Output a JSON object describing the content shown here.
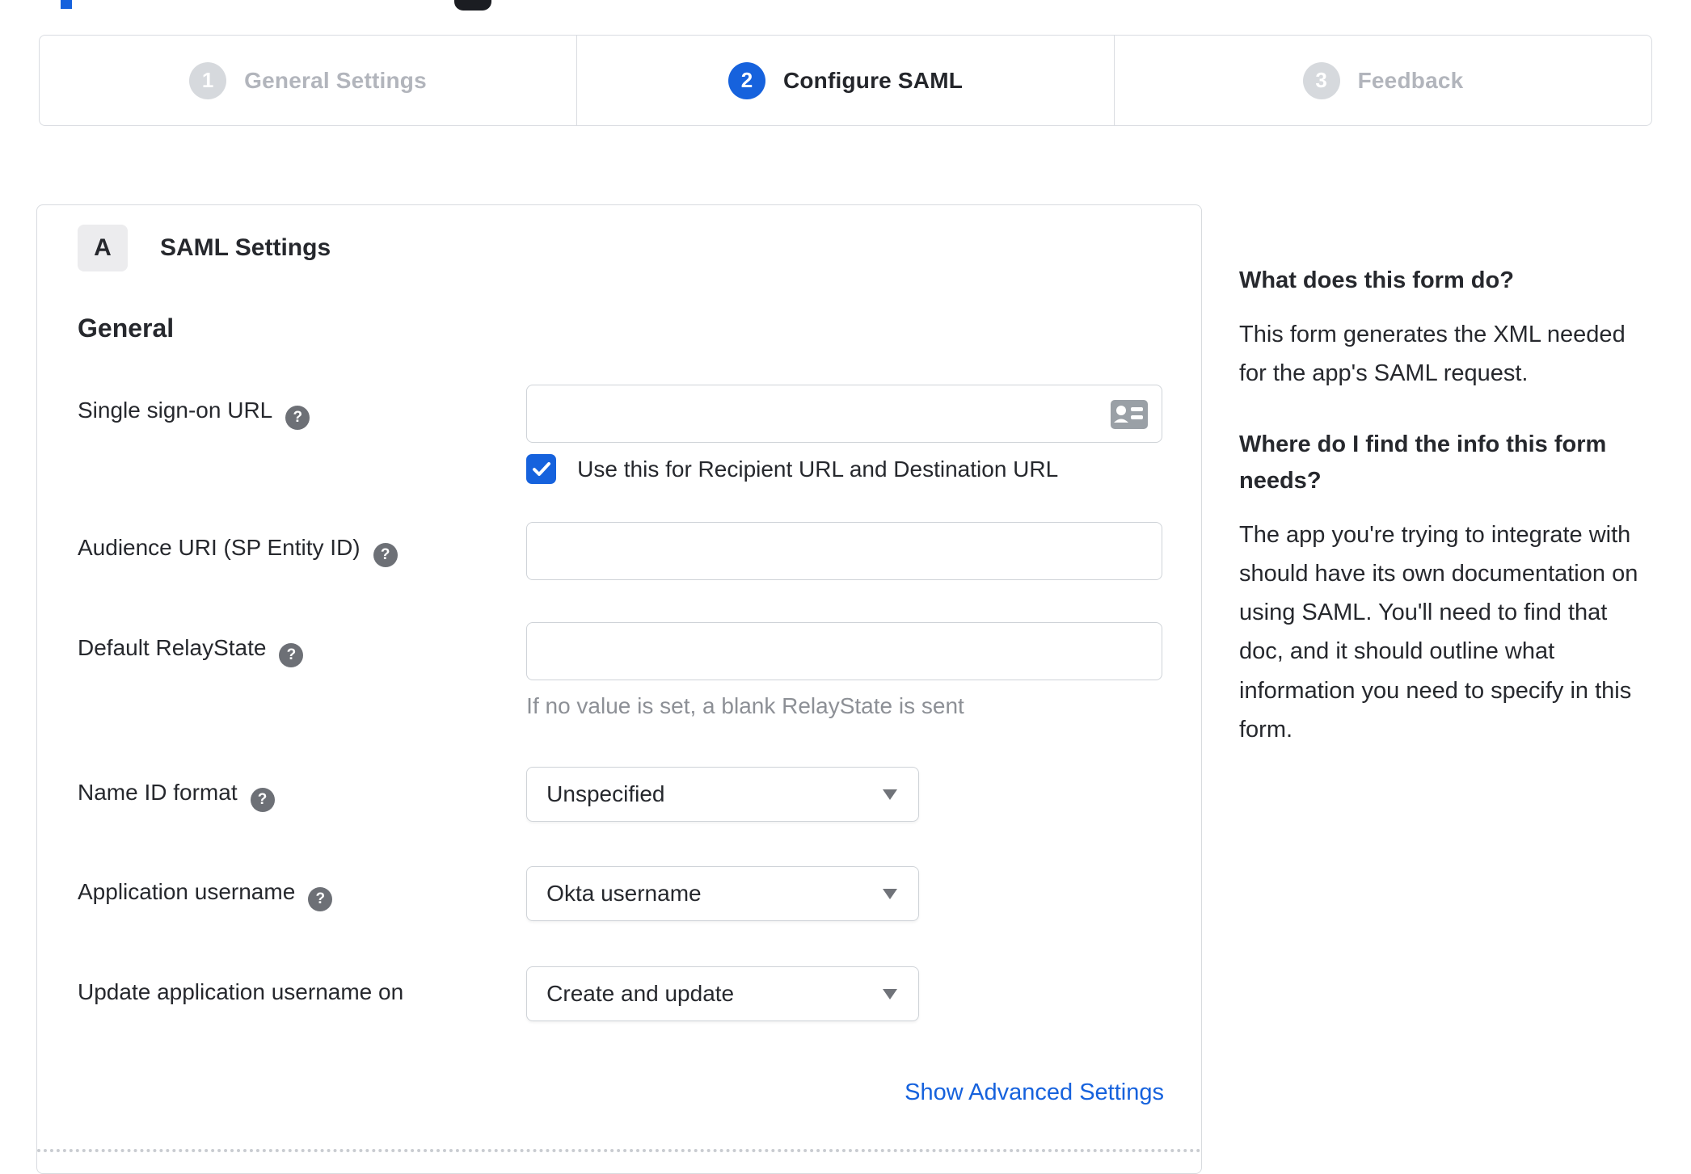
{
  "colors": {
    "accent_blue": "#1662dd",
    "inactive_step_gray": "#d6d9dd",
    "inactive_label_gray": "#b2b5bc",
    "text_dark": "#26282d",
    "helper_gray": "#8d9096",
    "link_blue": "#1662dd"
  },
  "stepper": {
    "steps": [
      {
        "number": "1",
        "label": "General Settings",
        "active": false
      },
      {
        "number": "2",
        "label": "Configure SAML",
        "active": true
      },
      {
        "number": "3",
        "label": "Feedback",
        "active": false
      }
    ]
  },
  "form": {
    "section_badge": "A",
    "section_title": "SAML Settings",
    "group_title": "General",
    "sso": {
      "label": "Single sign-on URL",
      "value": "",
      "checkbox_label": "Use this for Recipient URL and Destination URL",
      "checkbox_checked": true
    },
    "audience": {
      "label": "Audience URI (SP Entity ID)",
      "value": ""
    },
    "relay_state": {
      "label": "Default RelayState",
      "value": "",
      "helper": "If no value is set, a blank RelayState is sent"
    },
    "name_id_format": {
      "label": "Name ID format",
      "value": "Unspecified"
    },
    "app_username": {
      "label": "Application username",
      "value": "Okta username"
    },
    "update_username": {
      "label": "Update application username on",
      "value": "Create and update"
    },
    "advanced_link": "Show Advanced Settings"
  },
  "help_panel": {
    "q1": "What does this form do?",
    "a1": "This form generates the XML needed for the app's SAML request.",
    "q2": "Where do I find the info this form needs?",
    "a2": "The app you're trying to integrate with should have its own documentation on using SAML. You'll need to find that doc, and it should outline what information you need to specify in this form."
  }
}
